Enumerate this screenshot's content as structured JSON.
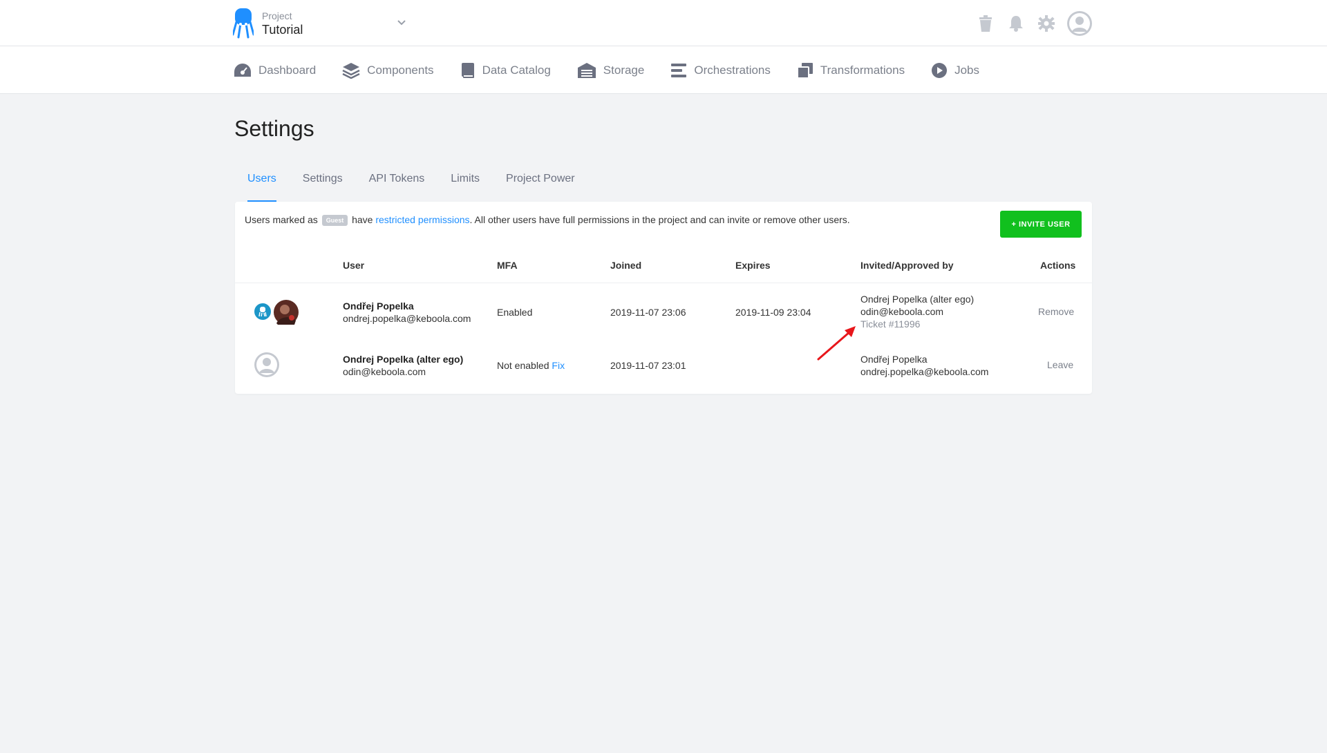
{
  "header": {
    "project_label": "Project",
    "project_name": "Tutorial"
  },
  "nav": [
    {
      "label": "Dashboard",
      "icon": "dashboard-icon"
    },
    {
      "label": "Components",
      "icon": "layers-icon"
    },
    {
      "label": "Data Catalog",
      "icon": "book-icon"
    },
    {
      "label": "Storage",
      "icon": "warehouse-icon"
    },
    {
      "label": "Orchestrations",
      "icon": "bars-icon"
    },
    {
      "label": "Transformations",
      "icon": "copy-icon"
    },
    {
      "label": "Jobs",
      "icon": "play-circle-icon"
    }
  ],
  "page": {
    "title": "Settings"
  },
  "tabs": [
    {
      "label": "Users",
      "active": true
    },
    {
      "label": "Settings",
      "active": false
    },
    {
      "label": "API Tokens",
      "active": false
    },
    {
      "label": "Limits",
      "active": false
    },
    {
      "label": "Project Power",
      "active": false
    }
  ],
  "info": {
    "prefix": "Users marked as",
    "badge": "Guest",
    "mid": "have",
    "link": "restricted permissions",
    "suffix": ". All other users have full permissions in the project and can invite or remove other users."
  },
  "invite_button": "+ INVITE USER",
  "table": {
    "headers": {
      "user": "User",
      "mfa": "MFA",
      "joined": "Joined",
      "expires": "Expires",
      "invited": "Invited/Approved by",
      "actions": "Actions"
    },
    "rows": [
      {
        "name": "Ondřej Popelka",
        "email": "ondrej.popelka@keboola.com",
        "mfa": "Enabled",
        "mfa_fix": "",
        "joined": "2019-11-07 23:06",
        "expires": "2019-11-09 23:04",
        "invited_name": "Ondrej Popelka (alter ego)",
        "invited_email": "odin@keboola.com",
        "ticket": "Ticket #11996",
        "action": "Remove"
      },
      {
        "name": "Ondrej Popelka (alter ego)",
        "email": "odin@keboola.com",
        "mfa": "Not enabled",
        "mfa_fix": "Fix",
        "joined": "2019-11-07 23:01",
        "expires": "",
        "invited_name": "Ondřej Popelka",
        "invited_email": "ondrej.popelka@keboola.com",
        "ticket": "",
        "action": "Leave"
      }
    ]
  },
  "colors": {
    "accent": "#1f8fff",
    "invite_green": "#11c01e",
    "annotation_red": "#e8161b"
  }
}
